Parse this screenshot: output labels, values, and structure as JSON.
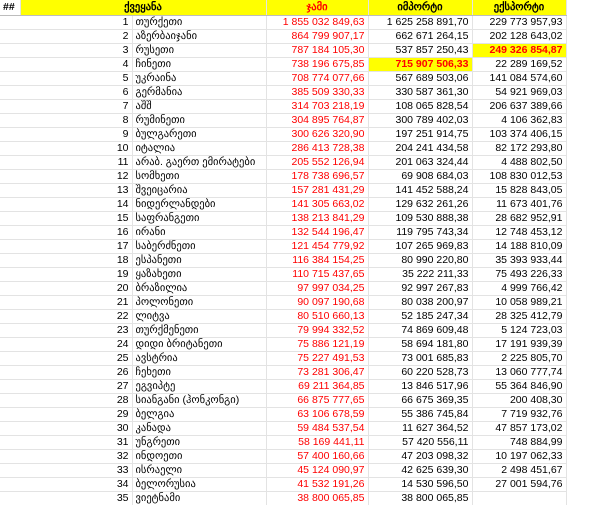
{
  "headers": {
    "num": "##",
    "country": "ქვეყანა",
    "total": "ჯამი",
    "import": "იმპორტი",
    "export": "ექსპორტი"
  },
  "rows": [
    {
      "n": "1",
      "country": "თურქეთი",
      "total": "1 855 032 849,63",
      "import": "1 625 258 891,70",
      "export": "229 773 957,93"
    },
    {
      "n": "2",
      "country": "აზერბაიჯანი",
      "total": "864 799 907,17",
      "import": "662 671 264,15",
      "export": "202 128 643,02"
    },
    {
      "n": "3",
      "country": "რუსეთი",
      "total": "787 184 105,30",
      "import": "537 857 250,43",
      "export": "249 326 854,87"
    },
    {
      "n": "4",
      "country": "ჩინეთი",
      "total": "738 196 675,85",
      "import": "715 907 506,33",
      "export": "22 289 169,52"
    },
    {
      "n": "5",
      "country": "უკრაინა",
      "total": "708 774 077,66",
      "import": "567 689 503,06",
      "export": "141 084 574,60"
    },
    {
      "n": "6",
      "country": "გერმანია",
      "total": "385 509 330,33",
      "import": "330 587 361,30",
      "export": "54 921 969,03"
    },
    {
      "n": "7",
      "country": "აშშ",
      "total": "314 703 218,19",
      "import": "108 065 828,54",
      "export": "206 637 389,66"
    },
    {
      "n": "8",
      "country": "რუმინეთი",
      "total": "304 895 764,87",
      "import": "300 789 402,03",
      "export": "4 106 362,83"
    },
    {
      "n": "9",
      "country": "ბულგარეთი",
      "total": "300 626 320,90",
      "import": "197 251 914,75",
      "export": "103 374 406,15"
    },
    {
      "n": "10",
      "country": "იტალია",
      "total": "286 413 728,38",
      "import": "204 241 434,58",
      "export": "82 172 293,80"
    },
    {
      "n": "11",
      "country": "არაბ. გაერთ ემირატები",
      "total": "205 552 126,94",
      "import": "201 063 324,44",
      "export": "4 488 802,50"
    },
    {
      "n": "12",
      "country": "სომხეთი",
      "total": "178 738 696,57",
      "import": "69 908 684,03",
      "export": "108 830 012,53"
    },
    {
      "n": "13",
      "country": "შვეიცარია",
      "total": "157 281 431,29",
      "import": "141 452 588,24",
      "export": "15 828 843,05"
    },
    {
      "n": "14",
      "country": "ნიდერლანდები",
      "total": "141 305 663,02",
      "import": "129 632 261,26",
      "export": "11 673 401,76"
    },
    {
      "n": "15",
      "country": "საფრანგეთი",
      "total": "138 213 841,29",
      "import": "109 530 888,38",
      "export": "28 682 952,91"
    },
    {
      "n": "16",
      "country": "ირანი",
      "total": "132 544 196,47",
      "import": "119 795 743,34",
      "export": "12 748 453,12"
    },
    {
      "n": "17",
      "country": "საბერძნეთი",
      "total": "121 454 779,92",
      "import": "107 265 969,83",
      "export": "14 188 810,09"
    },
    {
      "n": "18",
      "country": "ესპანეთი",
      "total": "116 384 154,25",
      "import": "80 990 220,80",
      "export": "35 393 933,44"
    },
    {
      "n": "19",
      "country": "ყაზახეთი",
      "total": "110 715 437,65",
      "import": "35 222 211,33",
      "export": "75 493 226,33"
    },
    {
      "n": "20",
      "country": "ბრაზილია",
      "total": "97 997 034,25",
      "import": "92 997 267,83",
      "export": "4 999 766,42"
    },
    {
      "n": "21",
      "country": "პოლონეთი",
      "total": "90 097 190,68",
      "import": "80 038 200,97",
      "export": "10 058 989,21"
    },
    {
      "n": "22",
      "country": "ლიტვა",
      "total": "80 510 660,13",
      "import": "52 185 247,34",
      "export": "28 325 412,79"
    },
    {
      "n": "23",
      "country": "თურქმენეთი",
      "total": "79 994 332,52",
      "import": "74 869 609,48",
      "export": "5 124 723,03"
    },
    {
      "n": "24",
      "country": "დიდი ბრიტანეთი",
      "total": "75 886 121,19",
      "import": "58 694 181,80",
      "export": "17 191 939,39"
    },
    {
      "n": "25",
      "country": "ავსტრია",
      "total": "75 227 491,53",
      "import": "73 001 685,83",
      "export": "2 225 805,70"
    },
    {
      "n": "26",
      "country": "ჩეხეთი",
      "total": "73 281 306,47",
      "import": "60 220 528,73",
      "export": "13 060 777,74"
    },
    {
      "n": "27",
      "country": "ეგვიპტე",
      "total": "69 211 364,85",
      "import": "13 846 517,96",
      "export": "55 364 846,90"
    },
    {
      "n": "28",
      "country": "სიანგანი (ჰონკონგი)",
      "total": "66 875 777,65",
      "import": "66 675 369,35",
      "export": "200 408,30"
    },
    {
      "n": "29",
      "country": "ბელგია",
      "total": "63 106 678,59",
      "import": "55 386 745,84",
      "export": "7 719 932,76"
    },
    {
      "n": "30",
      "country": "კანადა",
      "total": "59 484 537,54",
      "import": "11 627 364,52",
      "export": "47 857 173,02"
    },
    {
      "n": "31",
      "country": "უნგრეთი",
      "total": "58 169 441,11",
      "import": "57 420 556,11",
      "export": "748 884,99"
    },
    {
      "n": "32",
      "country": "ინდოეთი",
      "total": "57 400 160,66",
      "import": "47 203 098,32",
      "export": "10 197 062,33"
    },
    {
      "n": "33",
      "country": "ისრაელი",
      "total": "45 124 090,97",
      "import": "42 625 639,30",
      "export": "2 498 451,67"
    },
    {
      "n": "34",
      "country": "ბელორუსია",
      "total": "41 532 191,26",
      "import": "14 530 596,50",
      "export": "27 001 594,76"
    },
    {
      "n": "35",
      "country": "ვიეტნამი",
      "total": "38 800 065,85",
      "import": "38 800 065,85",
      "export": ""
    }
  ],
  "highlighted": [
    "3.export",
    "4.import"
  ],
  "colors": {
    "header_bg": "#ffff00",
    "total_text": "#ff0000",
    "highlight_bg": "#ffff00",
    "highlight_text": "#ff0000"
  }
}
